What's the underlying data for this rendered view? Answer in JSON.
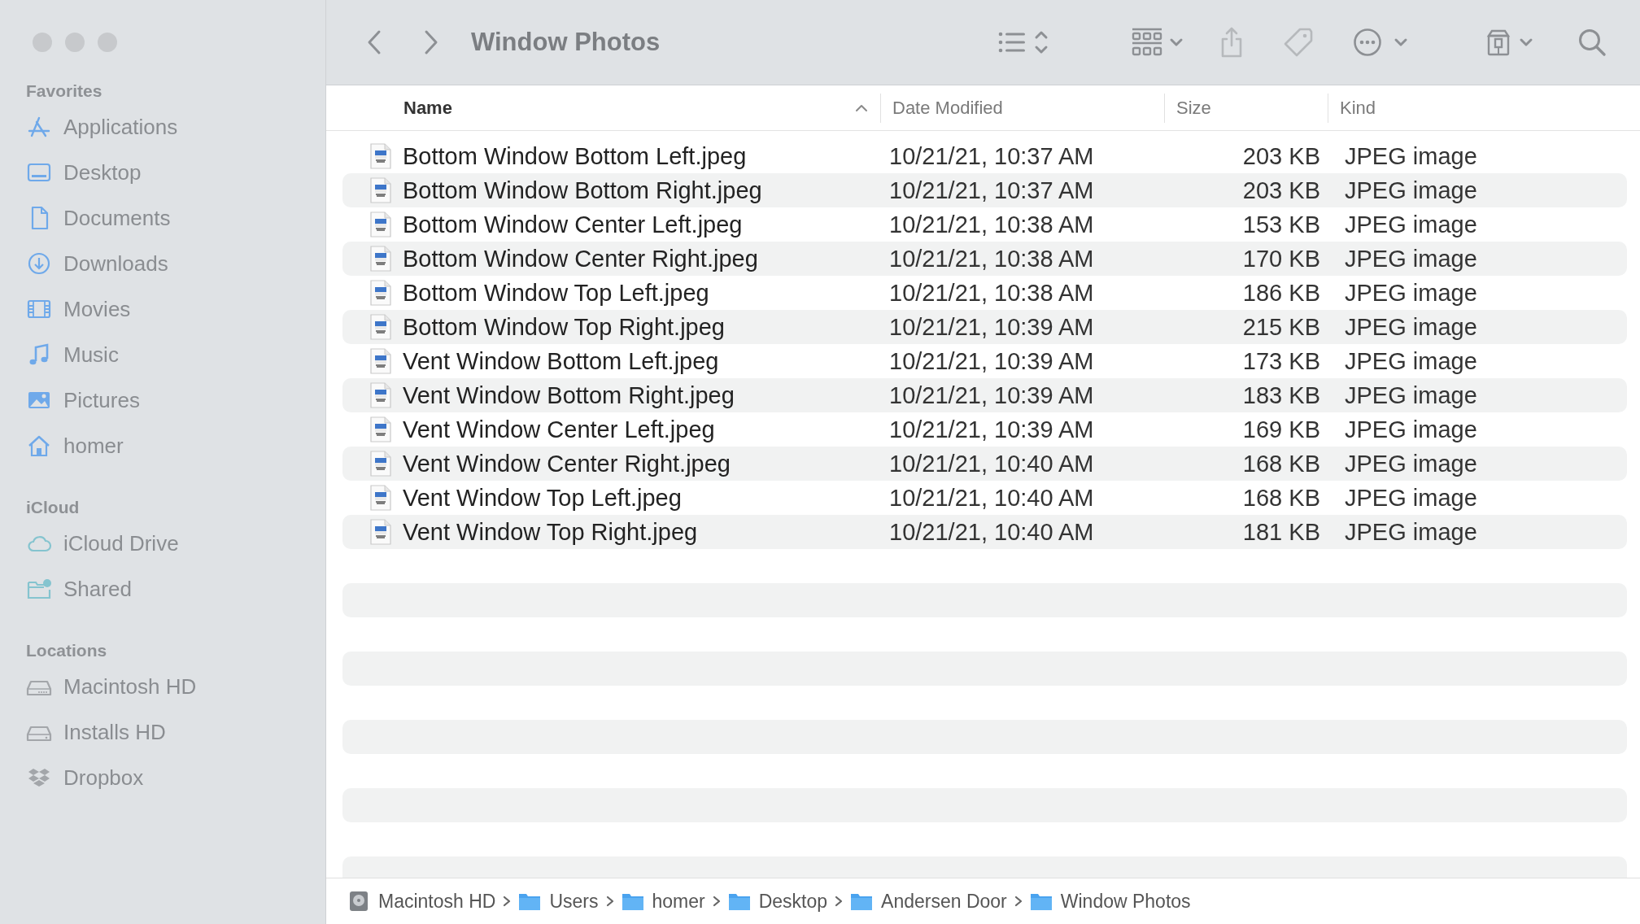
{
  "window": {
    "title": "Window Photos"
  },
  "sidebar": {
    "sections": [
      {
        "title": "Favorites",
        "items": [
          {
            "label": "Applications",
            "selected": false
          },
          {
            "label": "Desktop",
            "selected": false
          },
          {
            "label": "Documents",
            "selected": false
          },
          {
            "label": "Downloads",
            "selected": false
          },
          {
            "label": "Movies",
            "selected": false
          },
          {
            "label": "Music",
            "selected": false
          },
          {
            "label": "Pictures",
            "selected": false
          },
          {
            "label": "homer",
            "selected": false
          }
        ]
      },
      {
        "title": "iCloud",
        "items": [
          {
            "label": "iCloud Drive",
            "selected": false
          },
          {
            "label": "Shared",
            "selected": false
          }
        ]
      },
      {
        "title": "Locations",
        "items": [
          {
            "label": "Macintosh HD",
            "selected": false
          },
          {
            "label": "Installs HD",
            "selected": false
          },
          {
            "label": "Dropbox",
            "selected": false
          }
        ]
      }
    ]
  },
  "table": {
    "columns": [
      {
        "label": "Name",
        "sorted": true
      },
      {
        "label": "Date Modified",
        "sorted": false
      },
      {
        "label": "Size",
        "sorted": false
      },
      {
        "label": "Kind",
        "sorted": false
      }
    ],
    "rows": [
      {
        "name": "Bottom Window Bottom Left.jpeg",
        "date_modified": "10/21/21, 10:37 AM",
        "size": "203 KB",
        "kind": "JPEG image"
      },
      {
        "name": "Bottom Window Bottom Right.jpeg",
        "date_modified": "10/21/21, 10:37 AM",
        "size": "203 KB",
        "kind": "JPEG image"
      },
      {
        "name": "Bottom Window Center Left.jpeg",
        "date_modified": "10/21/21, 10:38 AM",
        "size": "153 KB",
        "kind": "JPEG image"
      },
      {
        "name": "Bottom Window Center Right.jpeg",
        "date_modified": "10/21/21, 10:38 AM",
        "size": "170 KB",
        "kind": "JPEG image"
      },
      {
        "name": "Bottom Window Top Left.jpeg",
        "date_modified": "10/21/21, 10:38 AM",
        "size": "186 KB",
        "kind": "JPEG image"
      },
      {
        "name": "Bottom Window Top Right.jpeg",
        "date_modified": "10/21/21, 10:39 AM",
        "size": "215 KB",
        "kind": "JPEG image"
      },
      {
        "name": "Vent Window Bottom Left.jpeg",
        "date_modified": "10/21/21, 10:39 AM",
        "size": "173 KB",
        "kind": "JPEG image"
      },
      {
        "name": "Vent Window Bottom Right.jpeg",
        "date_modified": "10/21/21, 10:39 AM",
        "size": "183 KB",
        "kind": "JPEG image"
      },
      {
        "name": "Vent Window Center Left.jpeg",
        "date_modified": "10/21/21, 10:39 AM",
        "size": "169 KB",
        "kind": "JPEG image"
      },
      {
        "name": "Vent Window Center Right.jpeg",
        "date_modified": "10/21/21, 10:40 AM",
        "size": "168 KB",
        "kind": "JPEG image"
      },
      {
        "name": "Vent Window Top Left.jpeg",
        "date_modified": "10/21/21, 10:40 AM",
        "size": "168 KB",
        "kind": "JPEG image"
      },
      {
        "name": "Vent Window Top Right.jpeg",
        "date_modified": "10/21/21, 10:40 AM",
        "size": "181 KB",
        "kind": "JPEG image"
      }
    ]
  },
  "path_bar": [
    {
      "label": "Macintosh HD",
      "kind": "disk"
    },
    {
      "label": "Users",
      "kind": "folder"
    },
    {
      "label": "homer",
      "kind": "folder"
    },
    {
      "label": "Desktop",
      "kind": "folder"
    },
    {
      "label": "Andersen Door",
      "kind": "folder"
    },
    {
      "label": "Window Photos",
      "kind": "folder"
    }
  ]
}
